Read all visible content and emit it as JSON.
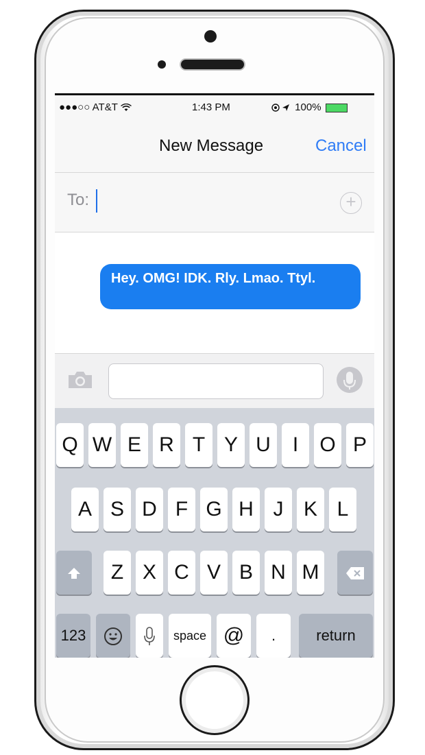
{
  "status_bar": {
    "carrier": "●●●○○ AT&T",
    "time": "1:43 PM",
    "battery": "100%"
  },
  "nav": {
    "title": "New Message",
    "cancel_label": "Cancel"
  },
  "to_field": {
    "label": "To:",
    "value": ""
  },
  "message": {
    "text": "Hey. OMG! IDK. Rly. Lmao. Ttyl."
  },
  "input_bar": {
    "text_value": ""
  },
  "keyboard": {
    "row1": [
      "Q",
      "W",
      "E",
      "R",
      "T",
      "Y",
      "U",
      "I",
      "O",
      "P"
    ],
    "row2": [
      "A",
      "S",
      "D",
      "F",
      "G",
      "H",
      "J",
      "K",
      "L"
    ],
    "row3": [
      "Z",
      "X",
      "C",
      "V",
      "B",
      "N",
      "M"
    ],
    "num_key": "123",
    "space_key": "space",
    "at_key": "@",
    "dot_key": ".",
    "return_key": "return"
  },
  "icons": [
    "wifi-icon",
    "location-icon",
    "battery-icon",
    "add-contact-icon",
    "camera-icon",
    "microphone-icon",
    "shift-icon",
    "backspace-icon",
    "emoji-icon",
    "dictation-icon",
    "home-button"
  ],
  "colors": {
    "accent": "#2f7cf6",
    "bubble": "#1a7ef0",
    "battery": "#4cd964"
  }
}
